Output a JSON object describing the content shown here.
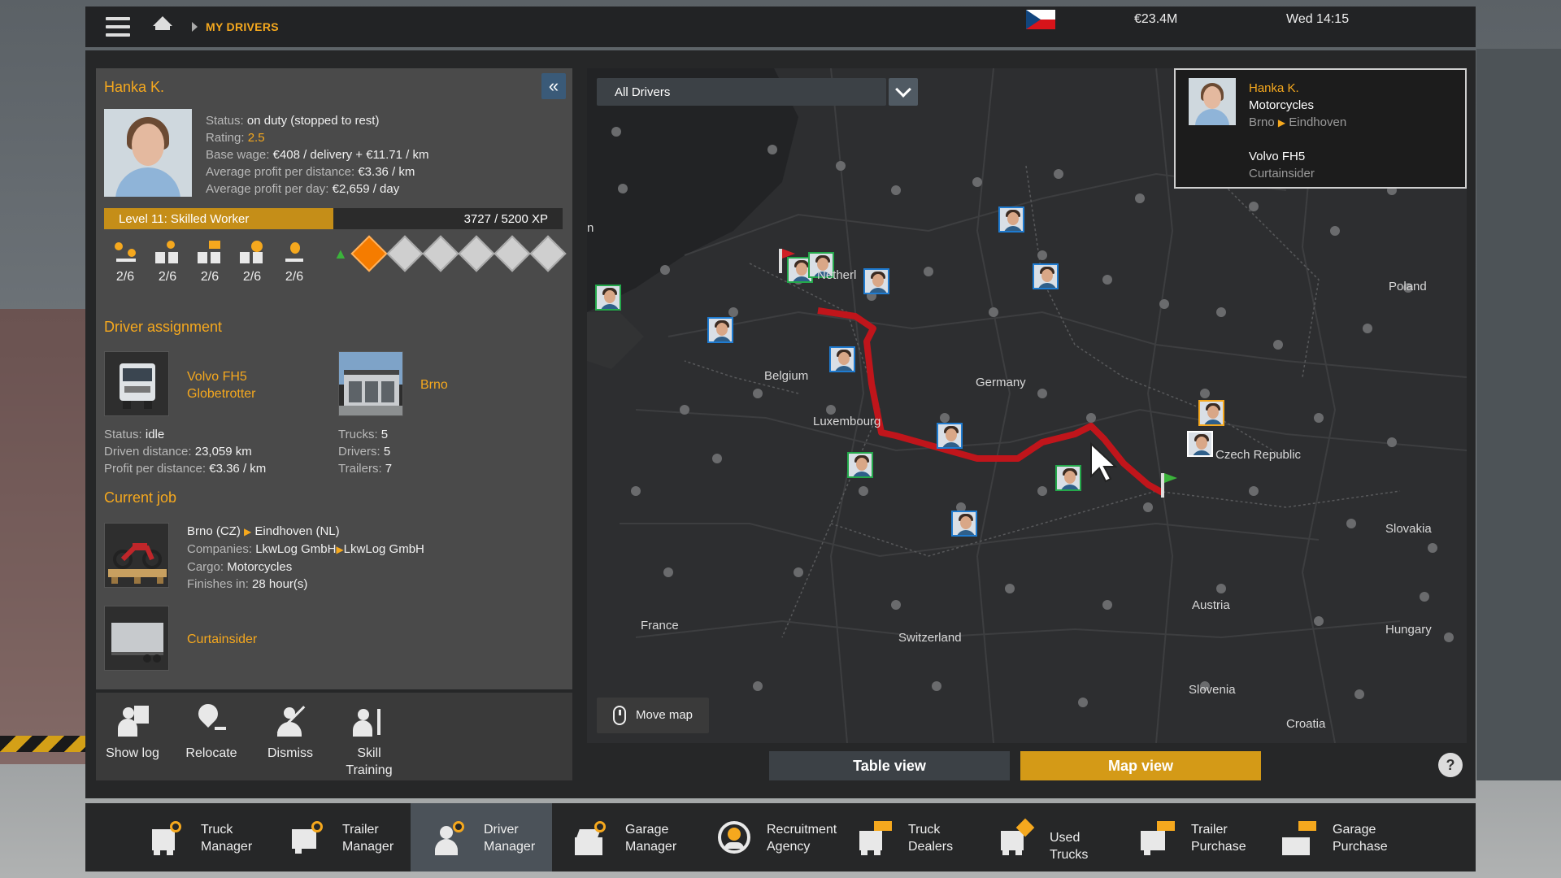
{
  "topbar": {
    "breadcrumb": "MY DRIVERS",
    "money": "€23.4M",
    "clock": "Wed 14:15"
  },
  "driver": {
    "name": "Hanka K.",
    "status_label": "Status:",
    "status_value": "on duty (stopped to rest)",
    "rating_label": "Rating:",
    "rating_value": "2.5",
    "wage_label": "Base wage:",
    "wage_value": "€408 / delivery + €11.71 / km",
    "profit_dist_label": "Average profit per distance:",
    "profit_dist_value": "€3.36 / km",
    "profit_day_label": "Average profit per day:",
    "profit_day_value": "€2,659 / day",
    "level_label": "Level 11: Skilled Worker",
    "xp_text": "3727 / 5200 XP",
    "xp_fraction": 0.5
  },
  "skills": [
    "2/6",
    "2/6",
    "2/6",
    "2/6",
    "2/6"
  ],
  "sections": {
    "assignment": "Driver assignment",
    "current_job": "Current job"
  },
  "assignment": {
    "truck_line1": "Volvo FH5",
    "truck_line2": "Globetrotter",
    "garage": "Brno",
    "truck_status_label": "Status:",
    "truck_status": "idle",
    "driven_label": "Driven distance:",
    "driven": "23,059 km",
    "ppd_label": "Profit per distance:",
    "ppd": "€3.36 / km",
    "trucks_label": "Trucks:",
    "trucks": "5",
    "drivers_label": "Drivers:",
    "drivers": "5",
    "trailers_label": "Trailers:",
    "trailers": "7"
  },
  "job": {
    "from": "Brno (CZ)",
    "to": "Eindhoven (NL)",
    "companies_label": "Companies:",
    "company_from": "LkwLog GmbH",
    "company_to": "LkwLog GmbH",
    "cargo_label": "Cargo:",
    "cargo": "Motorcycles",
    "finish_label": "Finishes in:",
    "finish": "28 hour(s)",
    "trailer": "Curtainsider"
  },
  "actions": {
    "show_log": "Show log",
    "relocate": "Relocate",
    "dismiss": "Dismiss",
    "skill_1": "Skill",
    "skill_2": "Training"
  },
  "map": {
    "filter": "All Drivers",
    "move_map": "Move map",
    "countries": {
      "poland": "Poland",
      "netherlands": "Netherl",
      "belgium": "Belgium",
      "germany": "Germany",
      "luxembourg": "Luxembourg",
      "czech": "Czech Republic",
      "slovakia": "Slovakia",
      "france": "France",
      "switzerland": "Switzerland",
      "austria": "Austria",
      "hungary": "Hungary",
      "slovenia": "Slovenia",
      "croatia": "Croatia",
      "edge": "n"
    },
    "route_color": "#c0151b"
  },
  "info_card": {
    "name": "Hanka K.",
    "cargo": "Motorcycles",
    "from": "Brno",
    "to": "Eindhoven",
    "truck": "Volvo FH5",
    "trailer": "Curtainsider"
  },
  "view": {
    "table": "Table view",
    "map": "Map view",
    "help": "?"
  },
  "bottom": [
    {
      "l1": "Truck",
      "l2": "Manager"
    },
    {
      "l1": "Trailer",
      "l2": "Manager"
    },
    {
      "l1": "Driver",
      "l2": "Manager"
    },
    {
      "l1": "Garage",
      "l2": "Manager"
    },
    {
      "l1": "Recruitment",
      "l2": "Agency"
    },
    {
      "l1": "Truck",
      "l2": "Dealers"
    },
    {
      "l1": "Used Trucks",
      "l2": ""
    },
    {
      "l1": "Trailer",
      "l2": "Purchase"
    },
    {
      "l1": "Garage",
      "l2": "Purchase"
    }
  ],
  "colors": {
    "accent": "#f5a81e",
    "active_tab": "#4b5259",
    "map_view_button": "#d49a17"
  }
}
